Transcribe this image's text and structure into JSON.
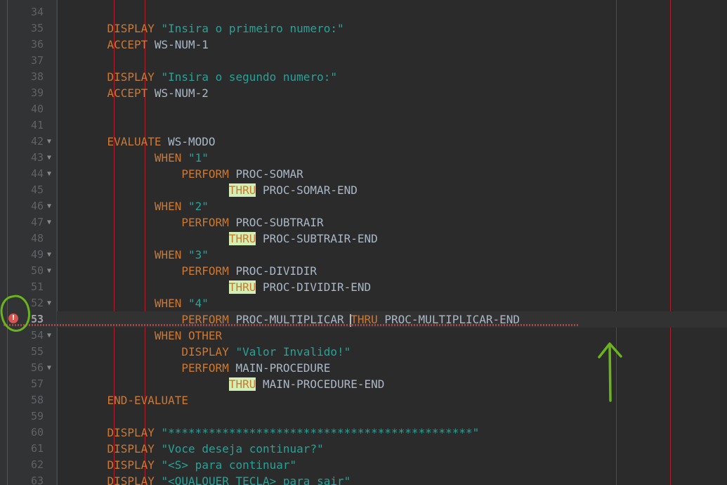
{
  "editor": {
    "current_line": 53,
    "error_icon_glyph": "!",
    "accent_colors": {
      "keyword": "#cc7832",
      "string": "#2aa198",
      "identifier": "#a9b7c6",
      "highlight_bg": "#d2f0b4",
      "margin_guide": "#b01e2a",
      "error": "#d9534f",
      "annotation": "#6ab41e"
    },
    "lines": [
      {
        "num": "34",
        "fold": "",
        "indent": "",
        "tokens": []
      },
      {
        "num": "35",
        "fold": "",
        "indent": "       ",
        "tokens": [
          {
            "t": "kw",
            "v": "DISPLAY"
          },
          {
            "t": "id",
            "v": " "
          },
          {
            "t": "str",
            "v": "\"Insira o primeiro numero:\""
          }
        ]
      },
      {
        "num": "36",
        "fold": "",
        "indent": "       ",
        "tokens": [
          {
            "t": "kw",
            "v": "ACCEPT"
          },
          {
            "t": "id",
            "v": " WS-NUM-1"
          }
        ]
      },
      {
        "num": "37",
        "fold": "",
        "indent": "",
        "tokens": []
      },
      {
        "num": "38",
        "fold": "",
        "indent": "       ",
        "tokens": [
          {
            "t": "kw",
            "v": "DISPLAY"
          },
          {
            "t": "id",
            "v": " "
          },
          {
            "t": "str",
            "v": "\"Insira o segundo numero:\""
          }
        ]
      },
      {
        "num": "39",
        "fold": "",
        "indent": "       ",
        "tokens": [
          {
            "t": "kw",
            "v": "ACCEPT"
          },
          {
            "t": "id",
            "v": " WS-NUM-2"
          }
        ]
      },
      {
        "num": "40",
        "fold": "",
        "indent": "",
        "tokens": []
      },
      {
        "num": "41",
        "fold": "",
        "indent": "",
        "tokens": []
      },
      {
        "num": "42",
        "fold": "▼",
        "indent": "       ",
        "tokens": [
          {
            "t": "kw",
            "v": "EVALUATE"
          },
          {
            "t": "id",
            "v": " WS-MODO"
          }
        ]
      },
      {
        "num": "43",
        "fold": "▼",
        "indent": "              ",
        "tokens": [
          {
            "t": "kw",
            "v": "WHEN"
          },
          {
            "t": "id",
            "v": " "
          },
          {
            "t": "str",
            "v": "\"1\""
          }
        ]
      },
      {
        "num": "44",
        "fold": "▼",
        "indent": "                  ",
        "tokens": [
          {
            "t": "kw",
            "v": "PERFORM"
          },
          {
            "t": "id",
            "v": " PROC-SOMAR"
          }
        ]
      },
      {
        "num": "45",
        "fold": "",
        "indent": "                         ",
        "tokens": [
          {
            "t": "hl",
            "v": "THRU"
          },
          {
            "t": "id",
            "v": " PROC-SOMAR-END"
          }
        ]
      },
      {
        "num": "46",
        "fold": "▼",
        "indent": "              ",
        "tokens": [
          {
            "t": "kw",
            "v": "WHEN"
          },
          {
            "t": "id",
            "v": " "
          },
          {
            "t": "str",
            "v": "\"2\""
          }
        ]
      },
      {
        "num": "47",
        "fold": "▼",
        "indent": "                  ",
        "tokens": [
          {
            "t": "kw",
            "v": "PERFORM"
          },
          {
            "t": "id",
            "v": " PROC-SUBTRAIR"
          }
        ]
      },
      {
        "num": "48",
        "fold": "",
        "indent": "                         ",
        "tokens": [
          {
            "t": "hl",
            "v": "THRU"
          },
          {
            "t": "id",
            "v": " PROC-SUBTRAIR-END"
          }
        ]
      },
      {
        "num": "49",
        "fold": "▼",
        "indent": "              ",
        "tokens": [
          {
            "t": "kw",
            "v": "WHEN"
          },
          {
            "t": "id",
            "v": " "
          },
          {
            "t": "str",
            "v": "\"3\""
          }
        ]
      },
      {
        "num": "50",
        "fold": "▼",
        "indent": "                  ",
        "tokens": [
          {
            "t": "kw",
            "v": "PERFORM"
          },
          {
            "t": "id",
            "v": " PROC-DIVIDIR"
          }
        ]
      },
      {
        "num": "51",
        "fold": "",
        "indent": "                         ",
        "tokens": [
          {
            "t": "hl",
            "v": "THRU"
          },
          {
            "t": "id",
            "v": " PROC-DIVIDIR-END"
          }
        ]
      },
      {
        "num": "52",
        "fold": "▼",
        "indent": "              ",
        "tokens": [
          {
            "t": "kw",
            "v": "WHEN"
          },
          {
            "t": "id",
            "v": " "
          },
          {
            "t": "str",
            "v": "\"4\""
          }
        ]
      },
      {
        "num": "53",
        "fold": "",
        "indent": "                  ",
        "tokens": [
          {
            "t": "kw",
            "v": "PERFORM"
          },
          {
            "t": "id",
            "v": " PROC-MULTIPLICAR "
          },
          {
            "t": "caret",
            "v": ""
          },
          {
            "t": "kw",
            "v": "THRU"
          },
          {
            "t": "id",
            "v": " PROC-MULTIPLICAR-END"
          }
        ]
      },
      {
        "num": "54",
        "fold": "▼",
        "indent": "              ",
        "tokens": [
          {
            "t": "kw",
            "v": "WHEN OTHER"
          }
        ]
      },
      {
        "num": "55",
        "fold": "",
        "indent": "                  ",
        "tokens": [
          {
            "t": "kw",
            "v": "DISPLAY"
          },
          {
            "t": "id",
            "v": " "
          },
          {
            "t": "str",
            "v": "\"Valor Invalido!\""
          }
        ]
      },
      {
        "num": "56",
        "fold": "▼",
        "indent": "                  ",
        "tokens": [
          {
            "t": "kw",
            "v": "PERFORM"
          },
          {
            "t": "id",
            "v": " MAIN-PROCEDURE"
          }
        ]
      },
      {
        "num": "57",
        "fold": "",
        "indent": "                         ",
        "tokens": [
          {
            "t": "hl",
            "v": "THRU"
          },
          {
            "t": "id",
            "v": " MAIN-PROCEDURE-END"
          }
        ]
      },
      {
        "num": "58",
        "fold": "",
        "indent": "       ",
        "tokens": [
          {
            "t": "kw",
            "v": "END-EVALUATE"
          }
        ]
      },
      {
        "num": "59",
        "fold": "",
        "indent": "",
        "tokens": []
      },
      {
        "num": "60",
        "fold": "",
        "indent": "       ",
        "tokens": [
          {
            "t": "kw",
            "v": "DISPLAY"
          },
          {
            "t": "id",
            "v": " "
          },
          {
            "t": "str",
            "v": "\"*********************************************\""
          }
        ]
      },
      {
        "num": "61",
        "fold": "",
        "indent": "       ",
        "tokens": [
          {
            "t": "kw",
            "v": "DISPLAY"
          },
          {
            "t": "id",
            "v": " "
          },
          {
            "t": "str",
            "v": "\"Voce deseja continuar?\""
          }
        ]
      },
      {
        "num": "62",
        "fold": "",
        "indent": "       ",
        "tokens": [
          {
            "t": "kw",
            "v": "DISPLAY"
          },
          {
            "t": "id",
            "v": " "
          },
          {
            "t": "str",
            "v": "\"<S> para continuar\""
          }
        ]
      },
      {
        "num": "63",
        "fold": "",
        "indent": "       ",
        "tokens": [
          {
            "t": "kw",
            "v": "DISPLAY"
          },
          {
            "t": "id",
            "v": " "
          },
          {
            "t": "str",
            "v": "\"<QUALQUER TECLA> para sair\""
          }
        ]
      }
    ]
  }
}
